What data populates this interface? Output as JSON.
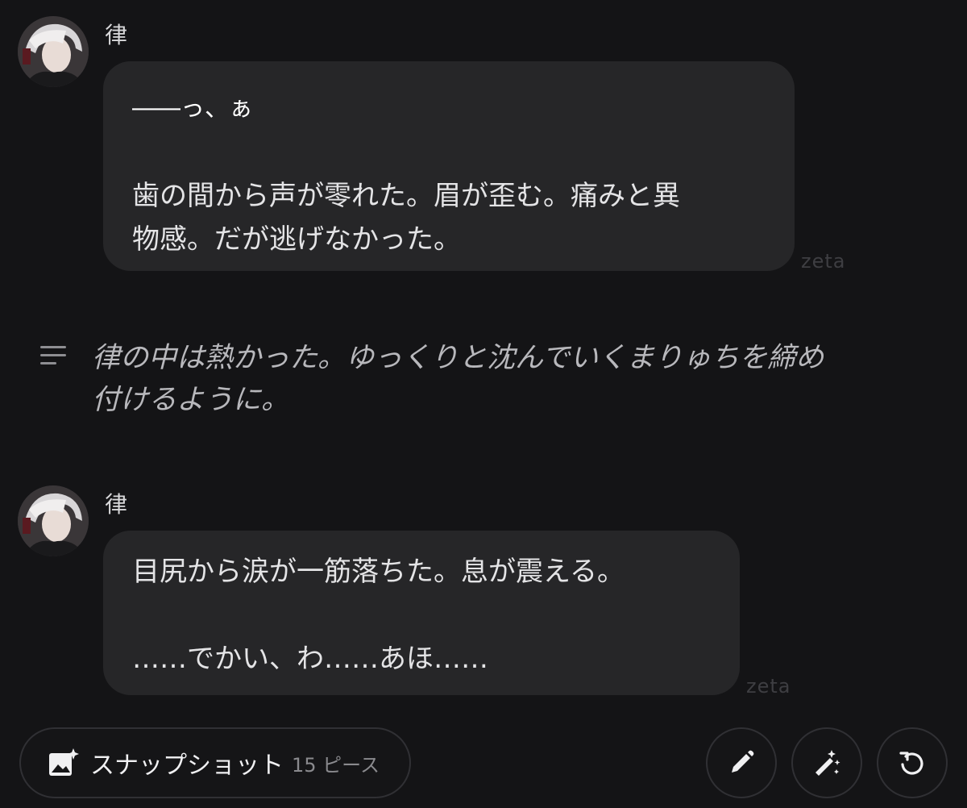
{
  "messages": [
    {
      "sender": "律",
      "lines": [
        "――っ、ぁ",
        "",
        "歯の間から声が零れた。眉が歪む。痛みと異",
        "物感。だが逃げなかった。"
      ],
      "watermark": "zeta"
    },
    {
      "sender": "律",
      "lines": [
        "目尻から涙が一筋落ちた。息が震える。",
        "",
        "……でかい、わ……あほ……"
      ],
      "watermark": "zeta"
    }
  ],
  "narration": {
    "icon": "lines-icon",
    "lines": [
      "律の中は熱かった。ゆっくりと沈んでいくまりゅちを締め",
      "付けるように。"
    ]
  },
  "toolbar": {
    "snapshot_icon": "image-sparkle-icon",
    "snapshot_label": "スナップショット",
    "snapshot_count": "15 ピース",
    "edit_icon": "pencil-icon",
    "magic_icon": "magic-wand-icon",
    "regenerate_icon": "refresh-icon"
  },
  "colors": {
    "background": "#141416",
    "bubble": "#262628",
    "border": "#303034"
  }
}
